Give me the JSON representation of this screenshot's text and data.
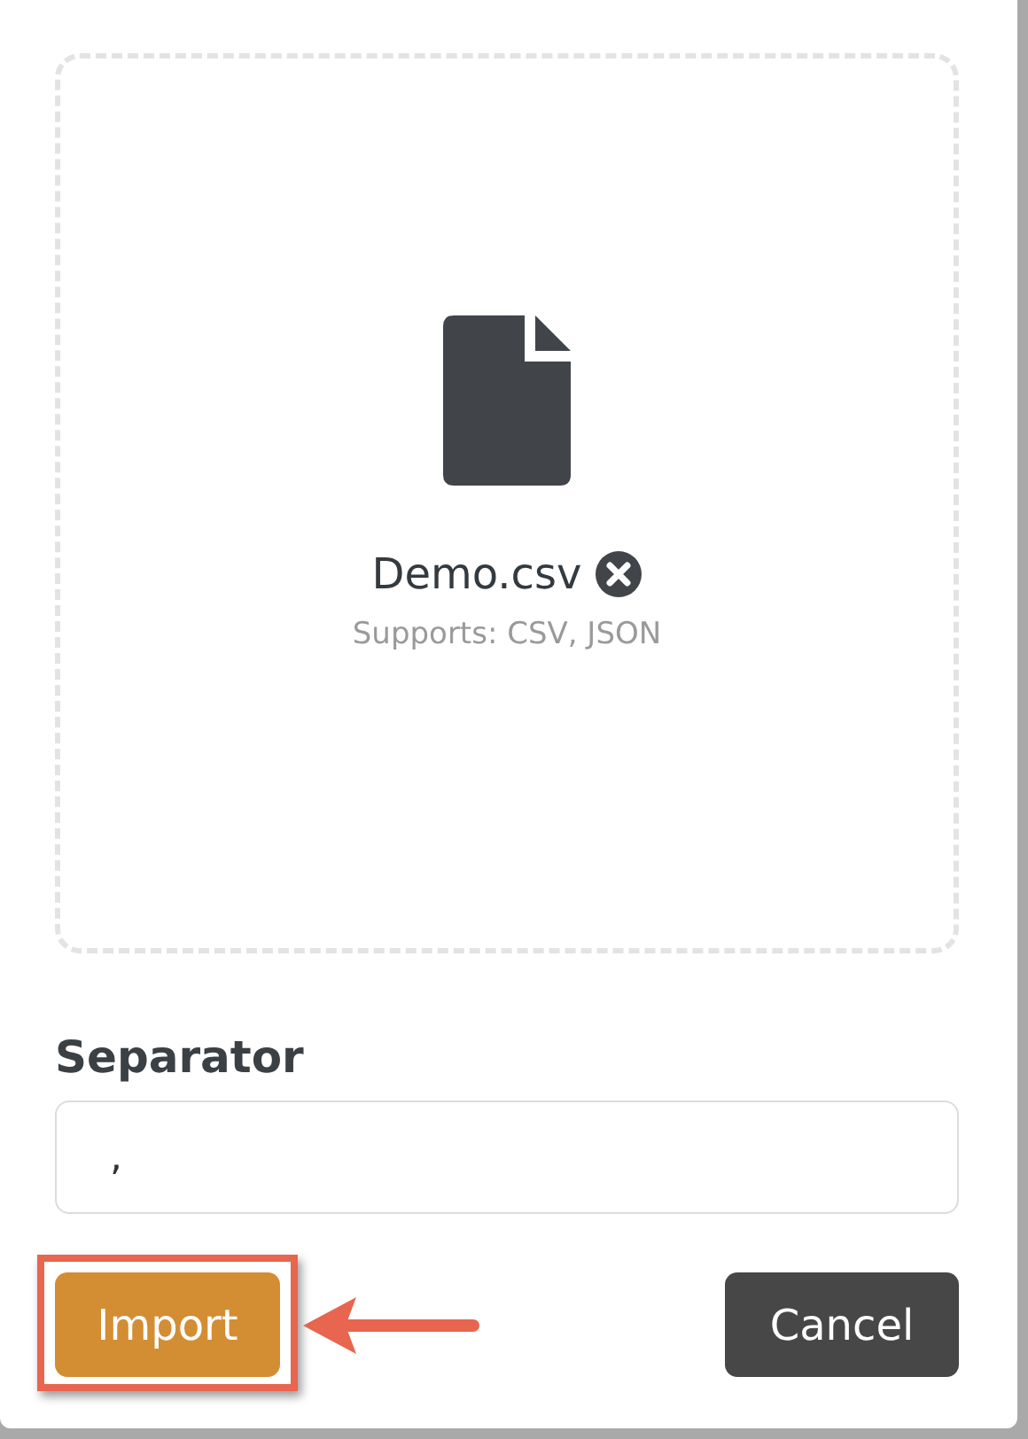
{
  "drop_zone": {
    "file_name": "Demo.csv",
    "supports": "Supports: CSV, JSON"
  },
  "separator": {
    "label": "Separator",
    "value": ","
  },
  "buttons": [
    {
      "label": "Import",
      "kind": "primary",
      "highlighted": true
    },
    {
      "label": "Cancel",
      "kind": "secondary",
      "highlighted": false
    }
  ]
}
